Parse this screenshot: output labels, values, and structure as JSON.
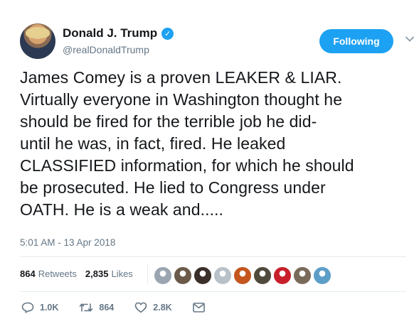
{
  "author": {
    "display_name": "Donald J. Trump",
    "handle": "@realDonaldTrump",
    "verified_icon": "verified-badge-icon"
  },
  "follow_button": {
    "label": "Following"
  },
  "menu_icon": "chevron-down-icon",
  "tweet": {
    "text": "James Comey is a proven LEAKER & LIAR. Virtually everyone in Washington thought he should be fired for the terrible job he did-until he was, in fact, fired. He leaked CLASSIFIED information, for which he should be prosecuted. He lied to Congress under OATH. He is a weak and.....",
    "lines": [
      "James Comey is a proven LEAKER & LIAR.",
      "Virtually everyone in Washington thought he",
      "should be fired for the terrible job he did-",
      "until he was, in fact, fired. He leaked",
      "CLASSIFIED information, for which he should",
      "be prosecuted. He lied to Congress under",
      "OATH. He is a weak and....."
    ],
    "timestamp": "5:01 AM - 13 Apr 2018"
  },
  "stats": {
    "retweets_count": "864",
    "retweets_label": "Retweets",
    "likes_count": "2,835",
    "likes_label": "Likes"
  },
  "likers": [
    {
      "color": "#9aa5b1"
    },
    {
      "color": "#6b5a4a"
    },
    {
      "color": "#3a2f2a"
    },
    {
      "color": "#b8c0c8"
    },
    {
      "color": "#c4561e"
    },
    {
      "color": "#4f4a3c"
    },
    {
      "color": "#c8202a"
    },
    {
      "color": "#7a6a5a"
    },
    {
      "color": "#5d9ec9"
    }
  ],
  "actions": {
    "reply_count": "1.0K",
    "retweet_count": "864",
    "like_count": "2.8K"
  },
  "colors": {
    "accent": "#1da1f2",
    "text": "#14171a",
    "muted": "#657786",
    "divider": "#e6ecf0"
  }
}
